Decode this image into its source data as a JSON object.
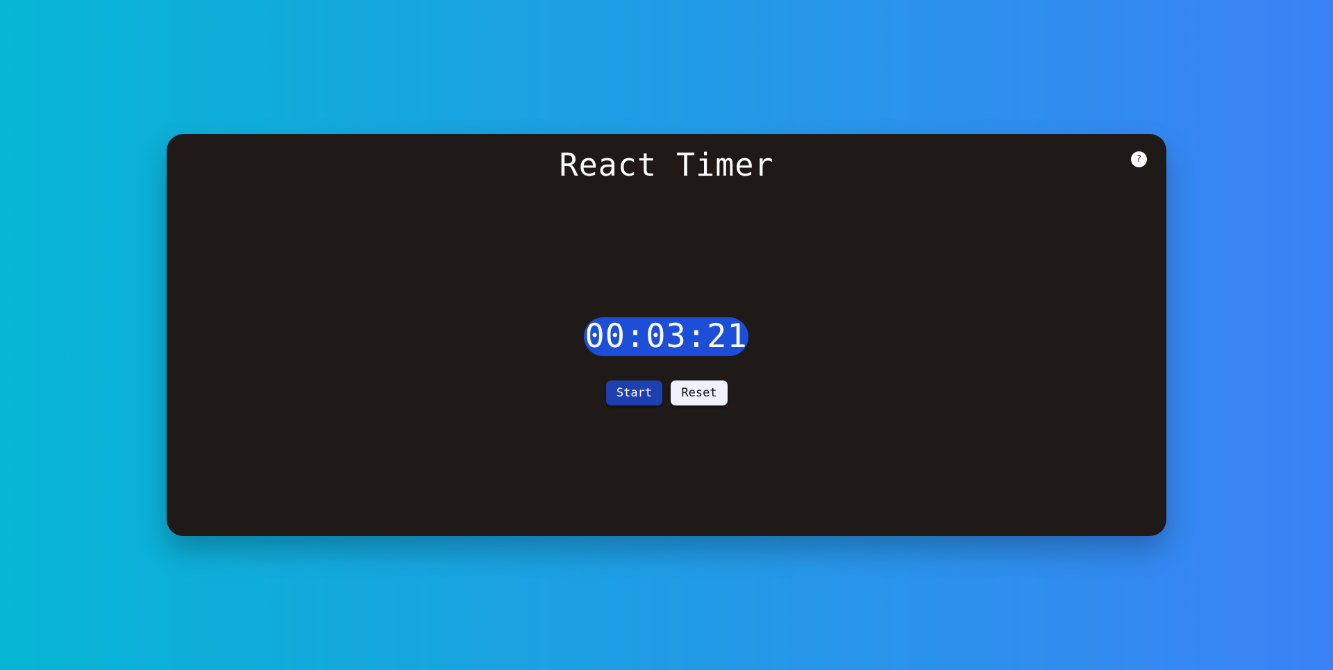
{
  "app": {
    "title": "React Timer",
    "help_label": "?"
  },
  "timer": {
    "display": "00:03:21"
  },
  "controls": {
    "start_label": "Start",
    "reset_label": "Reset"
  },
  "colors": {
    "background_gradient_start": "#06b6d4",
    "background_gradient_end": "#3b82f6",
    "card_background": "#1f1a17",
    "display_background": "#1d4ed8",
    "start_button": "#1e40af",
    "reset_button": "#eef2ff"
  },
  "icons": {
    "help": "question-mark-icon"
  }
}
